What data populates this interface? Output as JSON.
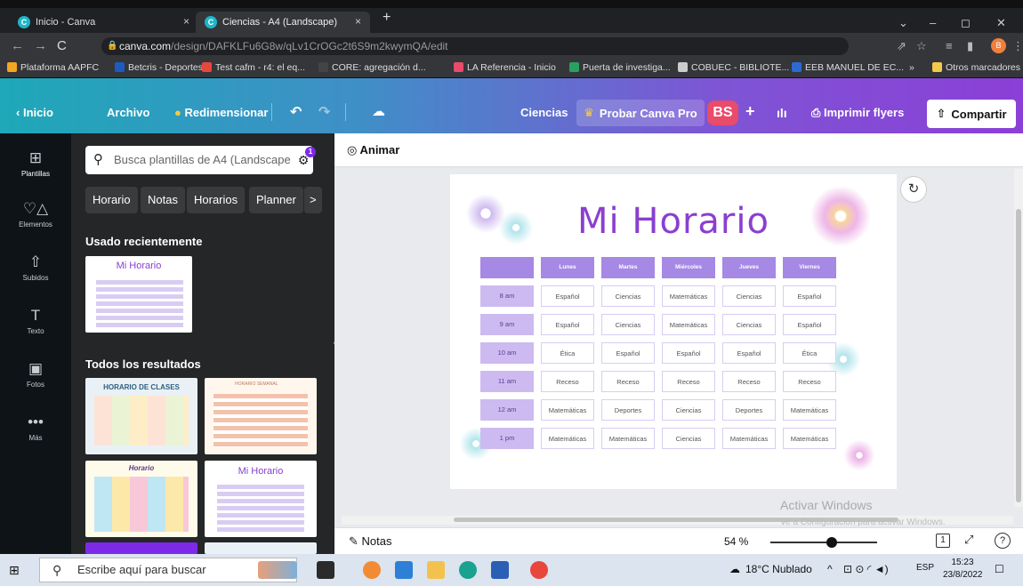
{
  "browser": {
    "tabs": [
      {
        "title": "Inicio - Canva",
        "close": "×"
      },
      {
        "title": "Ciencias - A4 (Landscape)",
        "close": "×"
      }
    ],
    "new_tab": "+",
    "window_controls": [
      "⌄",
      "–",
      "◻",
      "✕"
    ],
    "url_host": "canva.com",
    "url_path": "/design/DAFKLFu6G8w/qLv1CrOGc2t6S9m2kwymQA/edit",
    "profile_initial": "B",
    "bookmarks": [
      {
        "label": "Plataforma AAPFC",
        "color": "#f5a623"
      },
      {
        "label": "Betcris - Deportes",
        "color": "#1e5bbf"
      },
      {
        "label": "Test cafm - r4: el eq...",
        "color": "#e6483c"
      },
      {
        "label": "CORE: agregación d...",
        "color": "#444444"
      },
      {
        "label": "LA Referencia - Inicio",
        "color": "#e94b6a"
      },
      {
        "label": "Puerta de investiga...",
        "color": "#2aa060"
      },
      {
        "label": "COBUEC - BIBLIOTE...",
        "color": "#cccccc"
      },
      {
        "label": "EEB MANUEL DE EC...",
        "color": "#2d6ad1"
      }
    ],
    "bookmarks_more": "»",
    "other_bookmarks": "Otros marcadores"
  },
  "canva_header": {
    "home": "Inicio",
    "file": "Archivo",
    "resize": "Redimensionar",
    "doc_title": "Ciencias",
    "try_pro": "Probar Canva Pro",
    "avatar": "BS",
    "print": "Imprimir flyers",
    "share": "Compartir"
  },
  "rail": [
    {
      "label": "Plantillas",
      "icon": "⊞"
    },
    {
      "label": "Elementos",
      "icon": "♡△"
    },
    {
      "label": "Subidos",
      "icon": "⇧"
    },
    {
      "label": "Texto",
      "icon": "T"
    },
    {
      "label": "Fotos",
      "icon": "▣"
    },
    {
      "label": "Más",
      "icon": "•••"
    }
  ],
  "panel": {
    "search_placeholder": "Busca plantillas de A4 (Landscape",
    "filter_badge": "1",
    "chips": [
      "Horario",
      "Notas",
      "Horarios",
      "Planner",
      ">"
    ],
    "recent_title": "Usado recientemente",
    "all_title": "Todos los resultados",
    "thumbs": [
      "Mi Horario",
      "HORARIO DE CLASES",
      "HORARIO SEMANAL",
      "Horario",
      "Mi Horario"
    ]
  },
  "workspace": {
    "animate": "Animar",
    "notes": "Notas",
    "zoom": "54 %",
    "page_num": "1",
    "help": "?",
    "watermark_title": "Activar Windows",
    "watermark_sub": "Ve a Configuración para activar Windows."
  },
  "schedule": {
    "title": "Mi Horario",
    "days": [
      "Lunes",
      "Martes",
      "Miércoles",
      "Jueves",
      "Viernes"
    ],
    "rows": [
      {
        "time": "8 am",
        "cells": [
          "Español",
          "Ciencias",
          "Matemáticas",
          "Ciencias",
          "Español"
        ]
      },
      {
        "time": "9 am",
        "cells": [
          "Español",
          "Ciencias",
          "Matemáticas",
          "Ciencias",
          "Español"
        ]
      },
      {
        "time": "10 am",
        "cells": [
          "Ética",
          "Español",
          "Español",
          "Español",
          "Ética"
        ]
      },
      {
        "time": "11 am",
        "cells": [
          "Receso",
          "Receso",
          "Receso",
          "Receso",
          "Receso"
        ]
      },
      {
        "time": "12 am",
        "cells": [
          "Matemáticas",
          "Deportes",
          "Ciencias",
          "Deportes",
          "Matemáticas"
        ]
      },
      {
        "time": "1 pm",
        "cells": [
          "Matemáticas",
          "Matemáticas",
          "Ciencias",
          "Matemáticas",
          "Matemáticas"
        ]
      }
    ]
  },
  "taskbar": {
    "search": "Escribe aquí para buscar",
    "weather": "18°C Nublado",
    "lang": "ESP",
    "time": "15:23",
    "date": "23/8/2022"
  }
}
